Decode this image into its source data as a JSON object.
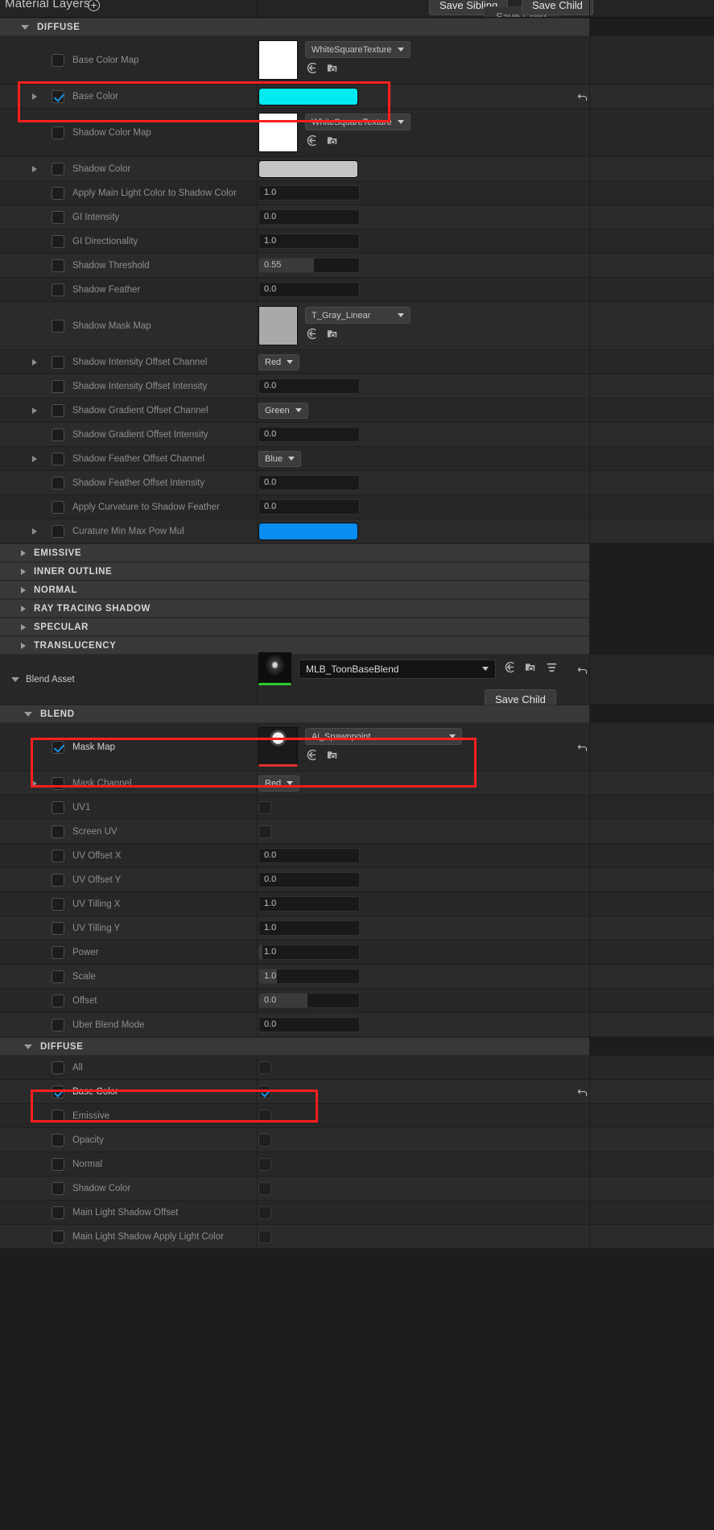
{
  "header": {
    "title": "Material Layers",
    "add_icon": "plus-circle-icon",
    "save_sibling_label": "Save Sibling",
    "save_child_label": "Save Child",
    "save_child_ghost_label": "Save Child"
  },
  "categories": {
    "diffuse": "DIFFUSE",
    "emissive": "EMISSIVE",
    "inner_outline": "INNER OUTLINE",
    "normal": "NORMAL",
    "ray_tracing_shadow": "RAY TRACING SHADOW",
    "specular": "SPECULAR",
    "translucency": "TRANSLUCENCY",
    "blend": "BLEND",
    "diffuse2": "DIFFUSE"
  },
  "colors": {
    "base_color_value": "#00eaf0",
    "shadow_color_value": "#c3c3c3",
    "curvature_value": "#0a8cf0",
    "checkbox_accent": "#1a8fe0",
    "highlight_box": "#ff1f1f",
    "thumbnail_green_bar": "#2ecc2e",
    "thumbnail_red_bar": "#e03030"
  },
  "diffuse_rows": [
    {
      "label": "Base Color Map",
      "checked": false,
      "expandable": false,
      "type": "texture",
      "texture": "WhiteSquareTexture",
      "thumb": "white"
    },
    {
      "label": "Base Color",
      "checked": true,
      "expandable": true,
      "type": "color",
      "color": "#00eaf0",
      "highlighted": true,
      "reset": true
    },
    {
      "label": "Shadow Color Map",
      "checked": false,
      "expandable": false,
      "type": "texture",
      "texture": "WhiteSquareTexture",
      "thumb": "white"
    },
    {
      "label": "Shadow Color",
      "checked": false,
      "expandable": true,
      "type": "color",
      "color": "#c3c3c3"
    },
    {
      "label": "Apply Main Light Color to Shadow Color",
      "checked": false,
      "expandable": false,
      "type": "number",
      "value": "1.0",
      "fill": 0
    },
    {
      "label": "GI Intensity",
      "checked": false,
      "expandable": false,
      "type": "number",
      "value": "0.0",
      "fill": 0
    },
    {
      "label": "GI Directionality",
      "checked": false,
      "expandable": false,
      "type": "number",
      "value": "1.0",
      "fill": 0
    },
    {
      "label": "Shadow Threshold",
      "checked": false,
      "expandable": false,
      "type": "number",
      "value": "0.55",
      "fill": 55
    },
    {
      "label": "Shadow Feather",
      "checked": false,
      "expandable": false,
      "type": "number",
      "value": "0.0",
      "fill": 0
    },
    {
      "label": "Shadow Mask Map",
      "checked": false,
      "expandable": false,
      "type": "texture",
      "texture": "T_Gray_Linear",
      "thumb": "gray"
    },
    {
      "label": "Shadow Intensity Offset Channel",
      "checked": false,
      "expandable": true,
      "type": "combo",
      "value": "Red"
    },
    {
      "label": "Shadow Intensity Offset Intensity",
      "checked": false,
      "expandable": false,
      "type": "number",
      "value": "0.0",
      "fill": 0
    },
    {
      "label": "Shadow Gradient Offset Channel",
      "checked": false,
      "expandable": true,
      "type": "combo",
      "value": "Green"
    },
    {
      "label": "Shadow Gradient Offset Intensity",
      "checked": false,
      "expandable": false,
      "type": "number",
      "value": "0.0",
      "fill": 0
    },
    {
      "label": "Shadow Feather Offset Channel",
      "checked": false,
      "expandable": true,
      "type": "combo",
      "value": "Blue"
    },
    {
      "label": "Shadow Feather Offset Intensity",
      "checked": false,
      "expandable": false,
      "type": "number",
      "value": "0.0",
      "fill": 0
    },
    {
      "label": "Apply Curvature to Shadow Feather",
      "checked": false,
      "expandable": false,
      "type": "number",
      "value": "0.0",
      "fill": 0
    },
    {
      "label": "Curature Min Max Pow Mul",
      "checked": false,
      "expandable": true,
      "type": "color",
      "color": "#0a8cf0"
    }
  ],
  "collapsed_categories": [
    "EMISSIVE",
    "INNER OUTLINE",
    "NORMAL",
    "RAY TRACING SHADOW",
    "SPECULAR",
    "TRANSLUCENCY"
  ],
  "blend_asset": {
    "label": "Blend Asset",
    "asset_name": "MLB_ToonBaseBlend",
    "save_child_label": "Save Child",
    "icons": [
      "browse-to-asset-icon",
      "use-selected-asset-icon",
      "filter-icon"
    ],
    "reset": true
  },
  "blend_rows": [
    {
      "label": "Mask Map",
      "checked": true,
      "expandable": false,
      "type": "texture",
      "texture": "Ai_Spawnpoint",
      "thumb": "spawnpoint",
      "highlighted": true,
      "bright": true,
      "reset": true
    },
    {
      "label": "Mask Channel",
      "checked": false,
      "expandable": true,
      "type": "combo",
      "value": "Red"
    },
    {
      "label": "UV1",
      "checked": false,
      "expandable": false,
      "type": "bool",
      "value": false
    },
    {
      "label": "Screen UV",
      "checked": false,
      "expandable": false,
      "type": "bool",
      "value": false
    },
    {
      "label": "UV Offset X",
      "checked": false,
      "expandable": false,
      "type": "number",
      "value": "0.0",
      "fill": 0
    },
    {
      "label": "UV Offset Y",
      "checked": false,
      "expandable": false,
      "type": "number",
      "value": "0.0",
      "fill": 0
    },
    {
      "label": "UV Tilling X",
      "checked": false,
      "expandable": false,
      "type": "number",
      "value": "1.0",
      "fill": 0
    },
    {
      "label": "UV Tilling Y",
      "checked": false,
      "expandable": false,
      "type": "number",
      "value": "1.0",
      "fill": 0
    },
    {
      "label": "Power",
      "checked": false,
      "expandable": false,
      "type": "number",
      "value": "1.0",
      "fill": 3
    },
    {
      "label": "Scale",
      "checked": false,
      "expandable": false,
      "type": "number",
      "value": "1.0",
      "fill": 18
    },
    {
      "label": "Offset",
      "checked": false,
      "expandable": false,
      "type": "number",
      "value": "0.0",
      "fill": 48
    },
    {
      "label": "Uber Blend Mode",
      "checked": false,
      "expandable": false,
      "type": "number",
      "value": "0.0",
      "fill": 0
    }
  ],
  "diffuse2_rows": [
    {
      "label": "All",
      "checked": false,
      "expandable": false,
      "type": "bool",
      "value": false
    },
    {
      "label": "Base Color",
      "checked": true,
      "expandable": false,
      "type": "bool",
      "value": true,
      "highlighted": true,
      "bright": true,
      "reset": true
    },
    {
      "label": "Emissive",
      "checked": false,
      "expandable": false,
      "type": "bool",
      "value": false
    },
    {
      "label": "Opacity",
      "checked": false,
      "expandable": false,
      "type": "bool",
      "value": false
    },
    {
      "label": "Normal",
      "checked": false,
      "expandable": false,
      "type": "bool",
      "value": false
    },
    {
      "label": "Shadow Color",
      "checked": false,
      "expandable": false,
      "type": "bool",
      "value": false
    },
    {
      "label": "Main Light Shadow Offset",
      "checked": false,
      "expandable": false,
      "type": "bool",
      "value": false
    },
    {
      "label": "Main Light Shadow Apply Light Color",
      "checked": false,
      "expandable": false,
      "type": "bool",
      "value": false
    }
  ]
}
